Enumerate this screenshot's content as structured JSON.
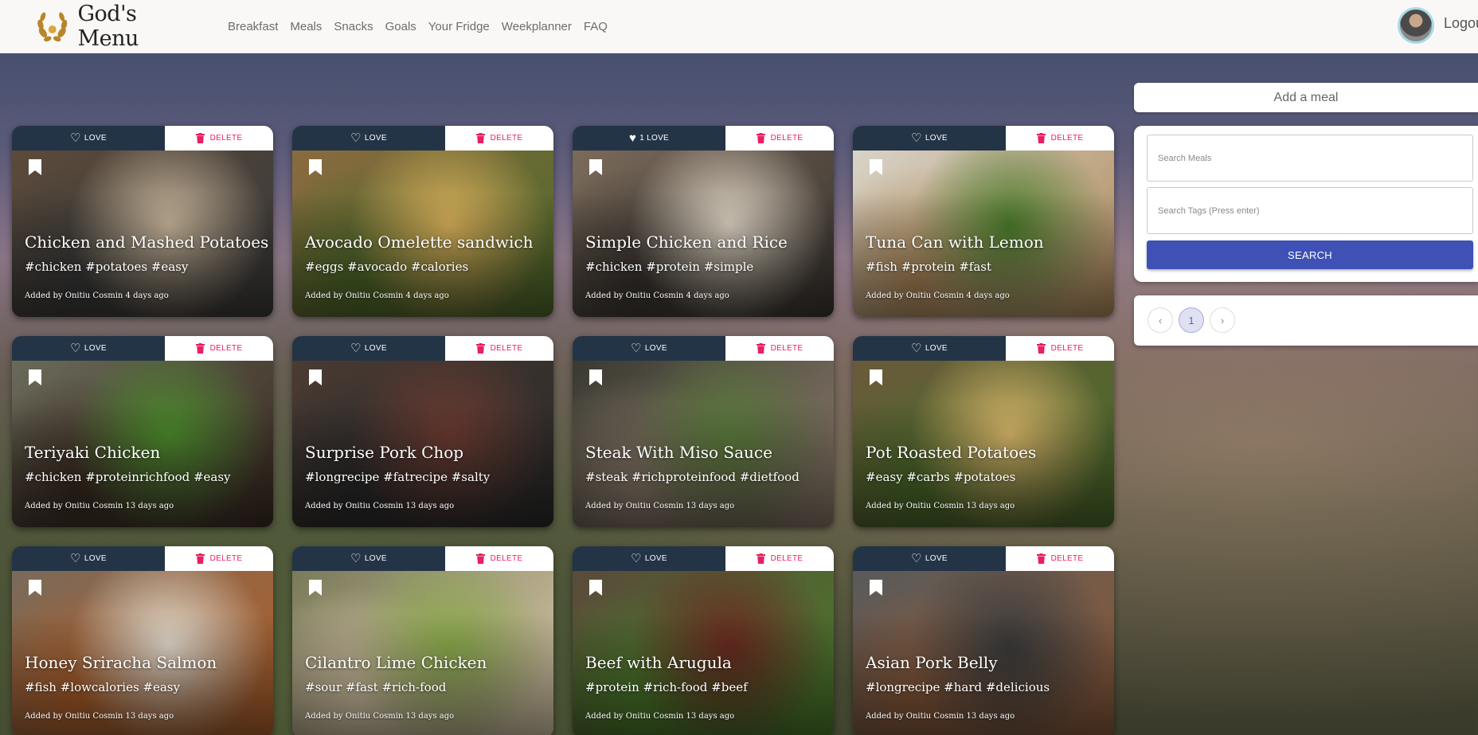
{
  "header": {
    "brand": "God's Menu",
    "nav": [
      "Breakfast",
      "Meals",
      "Snacks",
      "Goals",
      "Your Fridge",
      "Weekplanner",
      "FAQ"
    ],
    "logout": "Logou"
  },
  "sidebar": {
    "add_meal": "Add a meal",
    "search_meals_placeholder": "Search Meals",
    "search_tags_placeholder": "Search Tags (Press enter)",
    "search_button": "SEARCH",
    "pagination": {
      "prev": "‹",
      "page": "1",
      "next": "›"
    }
  },
  "cards": [
    {
      "love": "LOVE",
      "delete": "DELETE",
      "title": "Chicken and Mashed Potatoes",
      "tags": "#chicken #potatoes #easy",
      "meta": "Added by Onitiu Cosmin 4 days ago",
      "colors": [
        "#5b4a3a",
        "#c9b79c",
        "#3a3a3a"
      ]
    },
    {
      "love": "LOVE",
      "delete": "DELETE",
      "title": "Avocado Omelette sandwich",
      "tags": "#eggs #avocado #calories",
      "meta": "Added by Onitiu Cosmin 4 days ago",
      "colors": [
        "#8a6a40",
        "#d9b15a",
        "#4e6a2a"
      ]
    },
    {
      "love": "1 LOVE",
      "loved": true,
      "delete": "DELETE",
      "title": "Simple Chicken and Rice",
      "tags": "#chicken #protein #simple",
      "meta": "Added by Onitiu Cosmin 4 days ago",
      "colors": [
        "#7a6a5a",
        "#e0d6c6",
        "#3a3530"
      ]
    },
    {
      "love": "LOVE",
      "delete": "DELETE",
      "title": "Tuna Can with Lemon",
      "tags": "#fish #protein #fast",
      "meta": "Added by Onitiu Cosmin 4 days ago",
      "colors": [
        "#d8d3c8",
        "#4a7a2a",
        "#b08a5a"
      ]
    },
    {
      "love": "LOVE",
      "delete": "DELETE",
      "title": "Teriyaki Chicken",
      "tags": "#chicken #proteinrichfood #easy",
      "meta": "Added by Onitiu Cosmin 13 days ago",
      "colors": [
        "#6a6a5a",
        "#4a8a2a",
        "#3a2a20"
      ]
    },
    {
      "love": "LOVE",
      "delete": "DELETE",
      "title": "Surprise Pork Chop",
      "tags": "#longrecipe #fatrecipe #salty",
      "meta": "Added by Onitiu Cosmin 13 days ago",
      "colors": [
        "#4a3a32",
        "#6a3a30",
        "#2a2a2a"
      ]
    },
    {
      "love": "LOVE",
      "delete": "DELETE",
      "title": "Steak With Miso Sauce",
      "tags": "#steak #richproteinfood #dietfood",
      "meta": "Added by Onitiu Cosmin 13 days ago",
      "colors": [
        "#3a3a32",
        "#5a7a3a",
        "#8a7a6a"
      ]
    },
    {
      "love": "LOVE",
      "delete": "DELETE",
      "title": "Pot Roasted Potatoes",
      "tags": "#easy #carbs #potatoes",
      "meta": "Added by Onitiu Cosmin 13 days ago",
      "colors": [
        "#6a5a3a",
        "#d9b86a",
        "#4a6a2a"
      ]
    },
    {
      "love": "LOVE",
      "delete": "DELETE",
      "title": "Honey Sriracha Salmon",
      "tags": "#fish #lowcalories #easy",
      "meta": "Added by Onitiu Cosmin 13 days ago",
      "colors": [
        "#7a6a5a",
        "#e6ded0",
        "#b0602a"
      ]
    },
    {
      "love": "LOVE",
      "delete": "DELETE",
      "title": "Cilantro Lime Chicken",
      "tags": "#sour #fast #rich-food",
      "meta": "Added by Onitiu Cosmin 13 days ago",
      "colors": [
        "#7a7a5a",
        "#8aaa4a",
        "#d8c8a8"
      ]
    },
    {
      "love": "LOVE",
      "delete": "DELETE",
      "title": "Beef with Arugula",
      "tags": "#protein #rich-food #beef",
      "meta": "Added by Onitiu Cosmin 13 days ago",
      "colors": [
        "#5a4a3a",
        "#6a2a20",
        "#4a7a2a"
      ]
    },
    {
      "love": "LOVE",
      "delete": "DELETE",
      "title": "Asian Pork Belly",
      "tags": "#longrecipe #hard #delicious",
      "meta": "Added by Onitiu Cosmin 13 days ago",
      "colors": [
        "#5a5a5a",
        "#3a3a3a",
        "#8a5a3a"
      ]
    }
  ],
  "theme": {
    "navy": "#243447",
    "danger": "#e91e63",
    "primary": "#3f51b5"
  }
}
